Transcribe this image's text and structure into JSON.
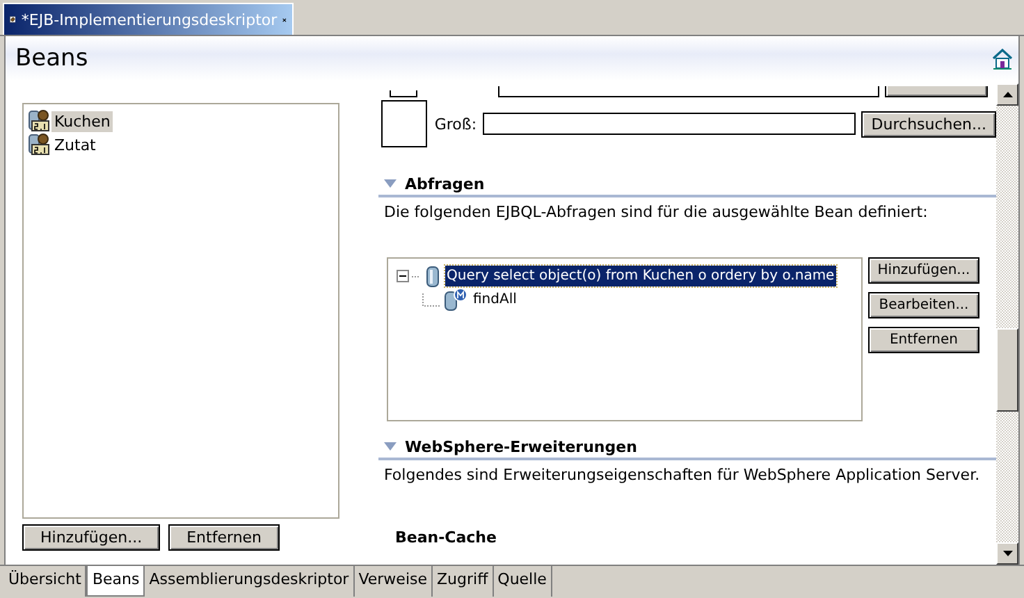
{
  "editor_tab": {
    "title": "*EJB-Implementierungsdeskriptor"
  },
  "header": {
    "title": "Beans"
  },
  "beans": {
    "items": [
      {
        "label": "Kuchen",
        "selected": true
      },
      {
        "label": "Zutat",
        "selected": false
      }
    ],
    "buttons": [
      "Hinzufügen...",
      "Entfernen"
    ]
  },
  "image_field": {
    "label": "Groß:",
    "button": "Durchsuchen..."
  },
  "queries": {
    "title": "Abfragen",
    "expanded": true,
    "description": "Die folgenden EJBQL-Abfragen sind für die ausgewählte Bean definiert:",
    "tree": [
      {
        "label": "Query select object(o) from Kuchen o ordery by o.name",
        "expanded": true,
        "selected": true,
        "children": [
          {
            "label": "findAll",
            "selected": false
          }
        ]
      }
    ],
    "buttons": [
      "Hinzufügen...",
      "Bearbeiten...",
      "Entfernen"
    ]
  },
  "websphere": {
    "title": "WebSphere-Erweiterungen",
    "expanded": true,
    "description": "Folgendes sind Erweiterungseigenschaften für WebSphere Application Server.",
    "subheading": "Bean-Cache"
  },
  "bottom_tabs": [
    {
      "label": "Übersicht",
      "selected": false
    },
    {
      "label": "Beans",
      "selected": true
    },
    {
      "label": "Assemblierungsdeskriptor",
      "selected": false
    },
    {
      "label": "Verweise",
      "selected": false
    },
    {
      "label": "Zugriff",
      "selected": false
    },
    {
      "label": "Quelle",
      "selected": false
    }
  ]
}
